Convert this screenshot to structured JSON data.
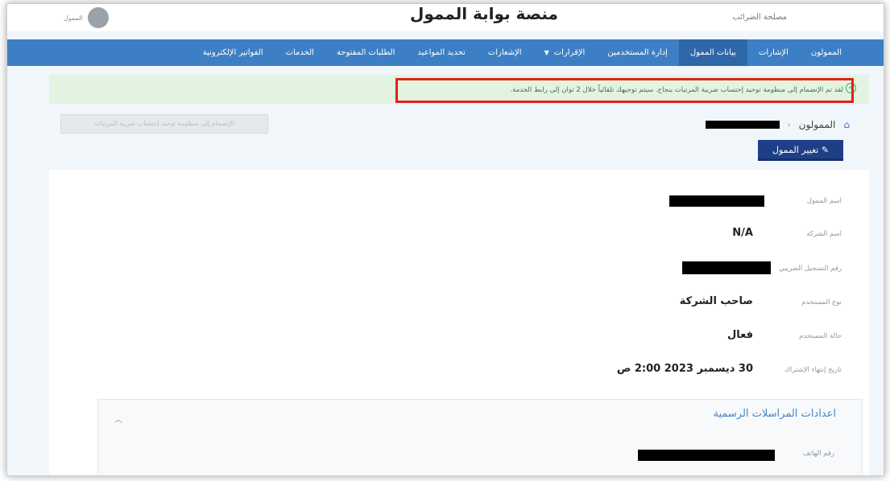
{
  "header": {
    "title": "منصة بوابة الممول",
    "user_label": "مصلحة الضرائب",
    "profile_text": "الممول"
  },
  "nav": {
    "items": [
      {
        "label": "الممولون",
        "active": false
      },
      {
        "label": "الإشارات",
        "active": false
      },
      {
        "label": "بيانات الممول",
        "active": true
      },
      {
        "label": "إدارة المستخدمين",
        "active": false
      },
      {
        "label": "الإقرارات",
        "active": false,
        "dropdown": true
      },
      {
        "label": "الإشعارات",
        "active": false
      },
      {
        "label": "تحديد المواعيد",
        "active": false
      },
      {
        "label": "الطلبات المفتوحة",
        "active": false
      },
      {
        "label": "الخدمات",
        "active": false
      },
      {
        "label": "الفواتير الإلكترونية",
        "active": false
      }
    ]
  },
  "alert": {
    "message": "لقد تم الإنضمام إلى منظومة توحيد إحتساب ضريبة المرتبات بنجاح. سيتم توجيهك تلقائياً خلال 2 ثوان إلى رابط الخدمة."
  },
  "breadcrumb": {
    "home": "الممولون"
  },
  "actions": {
    "join_label": "الإنضمام إلى منظومة توحيد إحتساب ضريبة المرتبات",
    "change_label": "تغيير الممول"
  },
  "details": {
    "name_label": "اسم الممول",
    "company_label": "اسم الشركة",
    "company_value": "N/A",
    "tax_reg_label": "رقم التسجيل الضريبي",
    "user_type_label": "نوع المستخدم",
    "user_type_value": "صاحب الشركة",
    "user_status_label": "حالة المستخدم",
    "user_status_value": "فعال",
    "sub_end_label": "تاريخ إنتهاء الإشتراك",
    "sub_end_value": "30 ديسمبر 2023 2:00 ص"
  },
  "correspondence": {
    "title": "اعدادات المراسلات الرسمية",
    "phone_label": "رقم الهاتف"
  },
  "colors": {
    "nav": "#3d7fc4",
    "nav_active": "#2e68a8",
    "alert_bg": "#e3f3e1",
    "highlight_border": "#e0211b",
    "primary_button": "#1e3f88"
  }
}
